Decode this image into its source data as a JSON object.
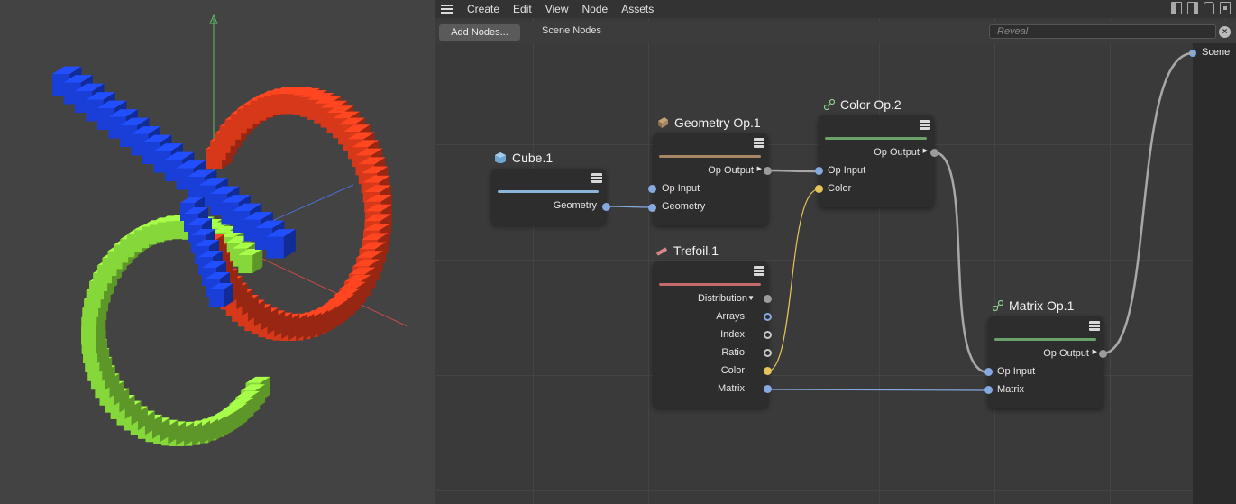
{
  "menubar": {
    "items": [
      "Create",
      "Edit",
      "View",
      "Node",
      "Assets"
    ]
  },
  "toolbar": {
    "add_nodes": "Add Nodes...",
    "scene_nodes": "Scene Nodes",
    "reveal_placeholder": "Reveal"
  },
  "scene": {
    "label": "Scene"
  },
  "nodes": {
    "cube": {
      "title": "Cube.1",
      "outputs": [
        "Geometry"
      ],
      "color": "#8ab4d8"
    },
    "geometry_op": {
      "title": "Geometry Op.1",
      "outputs": [
        "Op Output"
      ],
      "inputs": [
        "Op Input",
        "Geometry"
      ],
      "color": "#a58763"
    },
    "color_op": {
      "title": "Color Op.2",
      "outputs": [
        "Op Output"
      ],
      "inputs": [
        "Op Input",
        "Color"
      ],
      "color": "#6aa36a"
    },
    "trefoil": {
      "title": "Trefoil.1",
      "outputs": [
        "Distribution",
        "Arrays",
        "Index",
        "Ratio",
        "Color",
        "Matrix"
      ],
      "color": "#c46a6a"
    },
    "matrix_op": {
      "title": "Matrix Op.1",
      "outputs": [
        "Op Output"
      ],
      "inputs": [
        "Op Input",
        "Matrix"
      ],
      "color": "#6aa36a"
    }
  },
  "colors": {
    "blue_cubes": "#1a3fd8",
    "red_cubes": "#d8381a",
    "green_cubes": "#86d83a",
    "wire_gray": "#a8a8a8",
    "wire_blue": "#86aadf",
    "wire_yellow": "#e3c55a"
  }
}
